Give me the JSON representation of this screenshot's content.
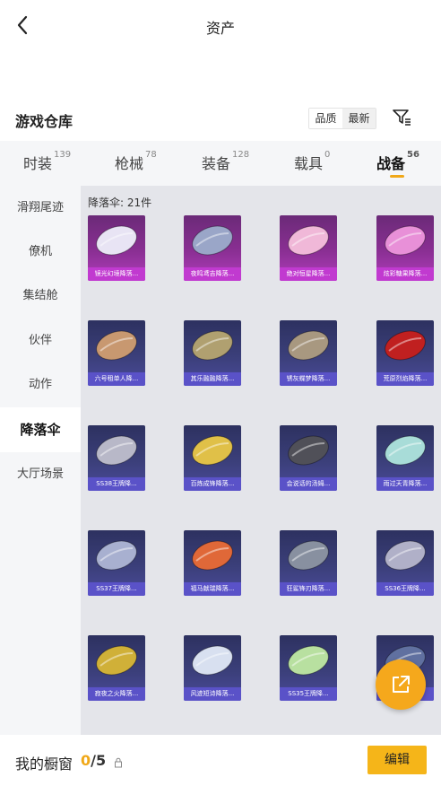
{
  "header": {
    "title": "资产"
  },
  "section": {
    "title": "游戏仓库",
    "sort_options": [
      "品质",
      "最新"
    ]
  },
  "tabs": [
    {
      "label": "时装",
      "count": "139"
    },
    {
      "label": "枪械",
      "count": "78"
    },
    {
      "label": "装备",
      "count": "128"
    },
    {
      "label": "载具",
      "count": "0"
    },
    {
      "label": "战备",
      "count": "56"
    }
  ],
  "active_tab": "战备",
  "sidebar": {
    "items": [
      "滑翔尾迹",
      "僚机",
      "集结舱",
      "伙伴",
      "动作",
      "降落伞",
      "大厅场景"
    ],
    "active": "降落伞"
  },
  "main": {
    "category_label": "降落伞: 21件",
    "items": [
      {
        "name": "镜光幻境降落...",
        "rarity": "purple",
        "color": "#e8e4f4"
      },
      {
        "name": "夜鸣鸢吉降落...",
        "rarity": "purple",
        "color": "#9aa6c8"
      },
      {
        "name": "绝对恒星降落...",
        "rarity": "purple",
        "color": "#f0b8d8"
      },
      {
        "name": "炫彩糖果降落...",
        "rarity": "purple",
        "color": "#e890d8"
      },
      {
        "name": "六号租单人降...",
        "rarity": "blue",
        "color": "#c89870"
      },
      {
        "name": "其乐融融降落...",
        "rarity": "blue",
        "color": "#b0a070"
      },
      {
        "name": "锈灰蝶梦降落...",
        "rarity": "blue",
        "color": "#a89880"
      },
      {
        "name": "荒原烈焰降落...",
        "rarity": "blue",
        "color": "#c02020"
      },
      {
        "name": "SS38王牌降...",
        "rarity": "blue",
        "color": "#b8b8c8"
      },
      {
        "name": "百炼成锋降落...",
        "rarity": "blue",
        "color": "#e0c048"
      },
      {
        "name": "会说话的汤姆...",
        "rarity": "blue",
        "color": "#505058"
      },
      {
        "name": "雨过天青降落...",
        "rarity": "blue",
        "color": "#a8dcd8"
      },
      {
        "name": "SS37王牌降...",
        "rarity": "blue",
        "color": "#a8b0d0"
      },
      {
        "name": "福马献瑞降落...",
        "rarity": "blue",
        "color": "#e06838"
      },
      {
        "name": "狂鲨锋刃降落...",
        "rarity": "blue",
        "color": "#8890a0"
      },
      {
        "name": "SS36王牌降...",
        "rarity": "blue",
        "color": "#b0b0c8"
      },
      {
        "name": "寂夜之火降落...",
        "rarity": "blue",
        "color": "#d0b038"
      },
      {
        "name": "风迹短诗降落...",
        "rarity": "blue",
        "color": "#d8e0f0"
      },
      {
        "name": "SS35王牌降...",
        "rarity": "blue",
        "color": "#b8e0a0"
      },
      {
        "name": "",
        "rarity": "blue",
        "color": "#6070a0"
      }
    ]
  },
  "fab": {
    "icon": "external-link-icon"
  },
  "footer": {
    "showcase_label": "我的橱窗",
    "used": "0",
    "total": "/5",
    "edit_label": "编辑"
  },
  "colors": {
    "accent": "#f5b519",
    "purple_rarity": "#c13ad0",
    "blue_rarity": "#5a52c8"
  }
}
